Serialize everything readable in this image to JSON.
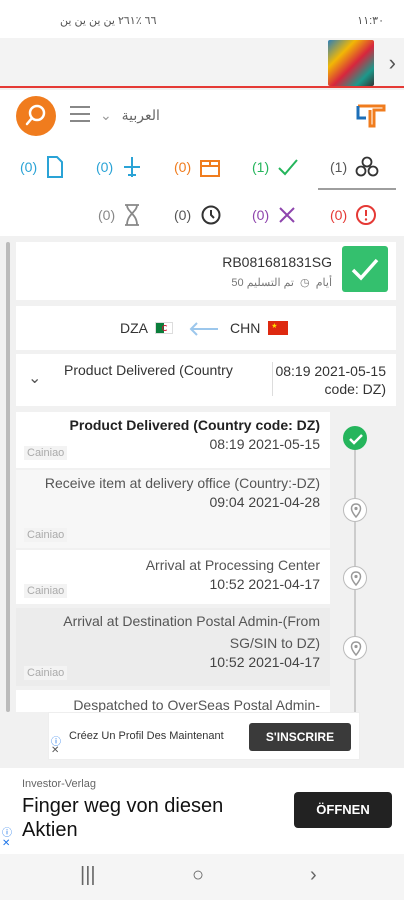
{
  "status_bar": {
    "left_text": "٦٦ ٪٢٦١  ﯾﻦ  ﯾﻦ  ﯾﻦ  ﯾﻦ",
    "right_text": "١١:٣٠"
  },
  "header": {
    "language": "العربية"
  },
  "tabs_row1": [
    {
      "count": "(0)",
      "icon": "document-icon",
      "color": "#2aa3d6"
    },
    {
      "count": "(0)",
      "icon": "plane-icon",
      "color": "#2aa3d6"
    },
    {
      "count": "(0)",
      "icon": "package-icon",
      "color": "#f07c1e"
    },
    {
      "count": "(1)",
      "icon": "check-icon",
      "color": "#25b55c"
    },
    {
      "count": "(1)",
      "icon": "all-packages-icon",
      "color": "#333333"
    }
  ],
  "tabs_row2": [
    {
      "count": "(0)",
      "icon": "hourglass-icon",
      "color": "#888888"
    },
    {
      "count": "(0)",
      "icon": "history-icon",
      "color": "#333333"
    },
    {
      "count": "(0)",
      "icon": "x-icon",
      "color": "#8e44ad"
    },
    {
      "count": "(0)",
      "icon": "alert-icon",
      "color": "#e53935"
    }
  ],
  "shipment": {
    "tracking_number": "RB081681831SG",
    "delivered_label": "تم التسليم",
    "days": "50 أيام",
    "from": "DZA",
    "to": "CHN",
    "summary_text": "Product Delivered (Country",
    "summary_date": "08:19 2021-05-15 code: DZ)"
  },
  "events": [
    {
      "title": "Product Delivered (Country code: DZ)",
      "time": "08:19 2021-05-15",
      "source": "Cainiao"
    },
    {
      "title": "Receive item at delivery office (Country:-DZ)",
      "time": "09:04 2021-04-28",
      "source": "Cainiao"
    },
    {
      "title": "Arrival at Processing Center",
      "time": "10:52 2021-04-17",
      "source": "Cainiao"
    },
    {
      "title": "Arrival at Destination Postal Admin-(From SG/SIN to DZ)",
      "time": "10:52 2021-04-17",
      "source": "Cainiao"
    },
    {
      "title": "Despatched to OverSeas Postal Admin-",
      "time": "",
      "source": ""
    }
  ],
  "ad_small": {
    "text": "Créez Un Profil Des Maintenant",
    "button": "S'INSCRIRE"
  },
  "ad_large": {
    "advertiser": "Investor-Verlag",
    "headline": "Finger weg von diesen Aktien",
    "button": "ÖFFNEN"
  },
  "colors": {
    "accent": "#f07c1e",
    "success": "#34c06e"
  }
}
